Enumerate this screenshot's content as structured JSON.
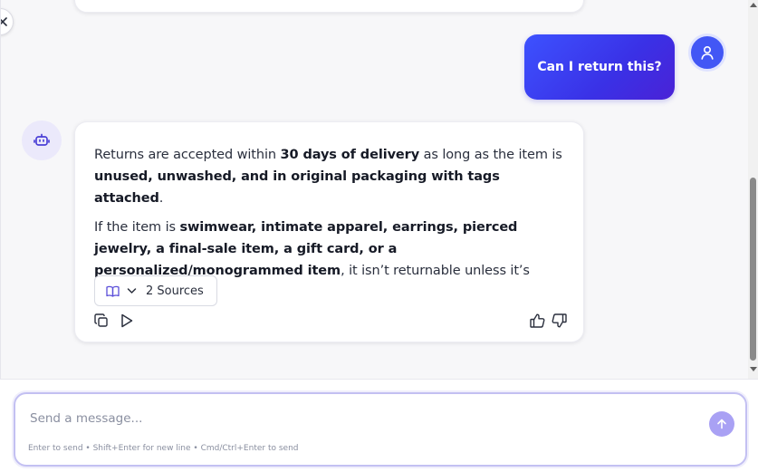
{
  "conversation": {
    "user_message": "Can I return this?",
    "bot_reply": {
      "p1": {
        "t1": "Returns are accepted within ",
        "b1": "30 days of delivery",
        "t2": " as long as the item is ",
        "b2": "unused, unwashed, and in original packaging with tags attached",
        "t3": "."
      },
      "p2": {
        "t1": "If the item is ",
        "b1": "swimwear, intimate apparel, earrings, pierced jewelry, a final-sale item, a gift card, or a personalized/monogrammed item",
        "t2": ", it isn’t returnable unless it’s defective."
      },
      "sources_label": "2 Sources"
    }
  },
  "composer": {
    "placeholder": "Send a message...",
    "value": "",
    "hint": "Enter to send • Shift+Enter for new line • Cmd/Ctrl+Enter to send"
  },
  "icons": {
    "collapse": "close-icon",
    "user_avatar": "user-icon",
    "bot_avatar": "robot-icon",
    "sources": "book-icon",
    "sources_toggle": "chevron-down-icon",
    "copy": "copy-icon",
    "read_aloud": "play-icon",
    "like": "thumbs-up-icon",
    "dislike": "thumbs-down-icon",
    "send": "arrow-up-icon"
  },
  "colors": {
    "accent": "#3d45f0",
    "send_button": "#a9a1f4",
    "input_border": "#c3c0f2",
    "bot_avatar_bg": "#ebe9fb"
  }
}
